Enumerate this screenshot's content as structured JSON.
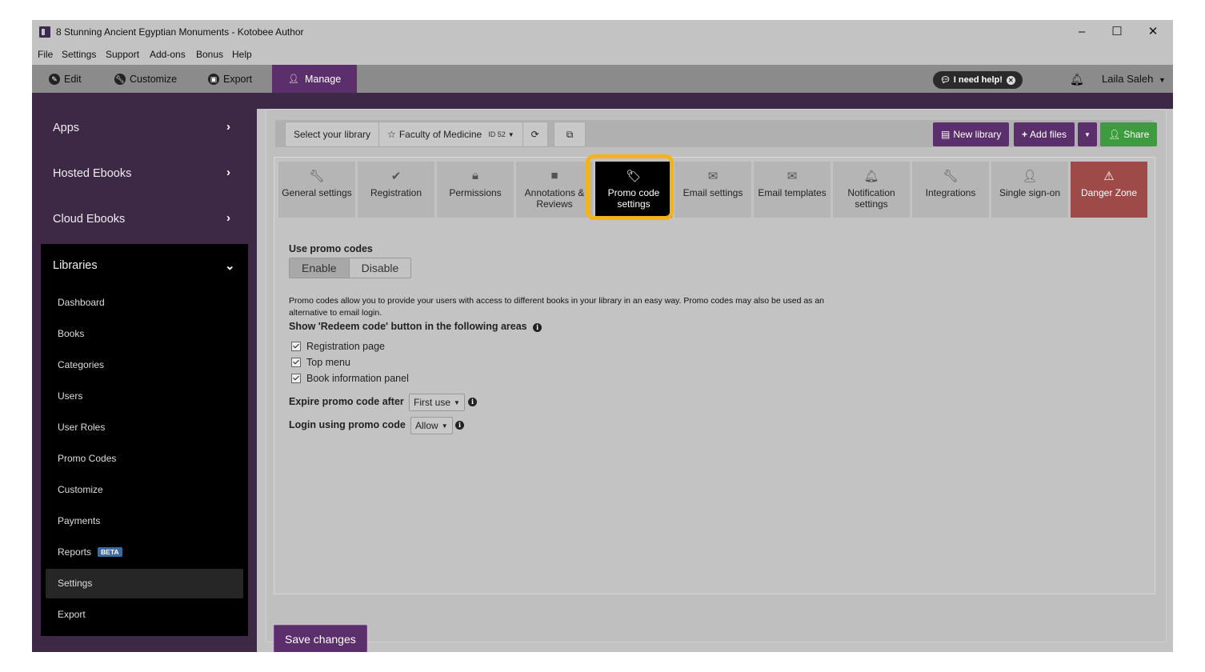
{
  "window": {
    "title": "8 Stunning Ancient Egyptian Monuments - Kotobee Author",
    "controls": {
      "minimize": "–",
      "maximize": "☐",
      "close": "✕"
    }
  },
  "menubar": [
    "File",
    "Settings",
    "Support",
    "Add-ons",
    "Bonus",
    "Help"
  ],
  "maintabs": [
    {
      "label": "Edit",
      "icon": "pencil-icon"
    },
    {
      "label": "Customize",
      "icon": "wrench-icon"
    },
    {
      "label": "Export",
      "icon": "export-icon"
    },
    {
      "label": "Manage",
      "icon": "user-icon"
    }
  ],
  "header": {
    "help_label": "I need help!",
    "user_name": "Laila Saleh"
  },
  "sidebar": {
    "items": [
      {
        "label": "Apps"
      },
      {
        "label": "Hosted Ebooks"
      },
      {
        "label": "Cloud Ebooks"
      }
    ],
    "libraries": {
      "label": "Libraries",
      "items": [
        {
          "label": "Dashboard"
        },
        {
          "label": "Books"
        },
        {
          "label": "Categories"
        },
        {
          "label": "Users"
        },
        {
          "label": "User Roles"
        },
        {
          "label": "Promo Codes"
        },
        {
          "label": "Customize"
        },
        {
          "label": "Payments"
        },
        {
          "label": "Reports",
          "badge": "BETA"
        },
        {
          "label": "Settings",
          "active": true
        },
        {
          "label": "Export"
        }
      ]
    }
  },
  "toolbar": {
    "select_label": "Select your library",
    "library_name": "Faculty of Medicine",
    "library_id": "ID 52",
    "new_library": "New library",
    "add_files": "Add files",
    "share": "Share"
  },
  "settings_tabs": [
    {
      "label": "General settings",
      "icon": "wrench-icon"
    },
    {
      "label": "Registration",
      "icon": "check-icon"
    },
    {
      "label": "Permissions",
      "icon": "lock-icon"
    },
    {
      "label": "Annotations & Reviews",
      "icon": "note-icon"
    },
    {
      "label": "Promo code settings",
      "icon": "tag-icon",
      "active": true
    },
    {
      "label": "Email settings",
      "icon": "envelope-icon"
    },
    {
      "label": "Email templates",
      "icon": "envelope-icon"
    },
    {
      "label": "Notification settings",
      "icon": "bell-icon"
    },
    {
      "label": "Integrations",
      "icon": "wrench-icon"
    },
    {
      "label": "Single sign-on",
      "icon": "user-icon"
    },
    {
      "label": "Danger Zone",
      "icon": "warning-icon",
      "danger": true
    }
  ],
  "promo": {
    "use_label": "Use promo codes",
    "enable": "Enable",
    "disable": "Disable",
    "selected": "Enable",
    "description": "Promo codes allow you to provide your users with access to different books in your library in an easy way. Promo codes may also be used as an alternative to email login.",
    "redeem_label": "Show 'Redeem code' button in the following areas",
    "redeem_areas": [
      {
        "label": "Registration page",
        "checked": true
      },
      {
        "label": "Top menu",
        "checked": true
      },
      {
        "label": "Book information panel",
        "checked": true
      }
    ],
    "expire_label": "Expire promo code after",
    "expire_value": "First use",
    "login_label": "Login using promo code",
    "login_value": "Allow"
  },
  "save_label": "Save changes",
  "colors": {
    "brand_purple": "#5b2f6b",
    "sidebar_bg": "#3d2845",
    "share_green": "#3f9b3f",
    "danger_red": "#9d4a48",
    "highlight": "#f5b31b"
  }
}
